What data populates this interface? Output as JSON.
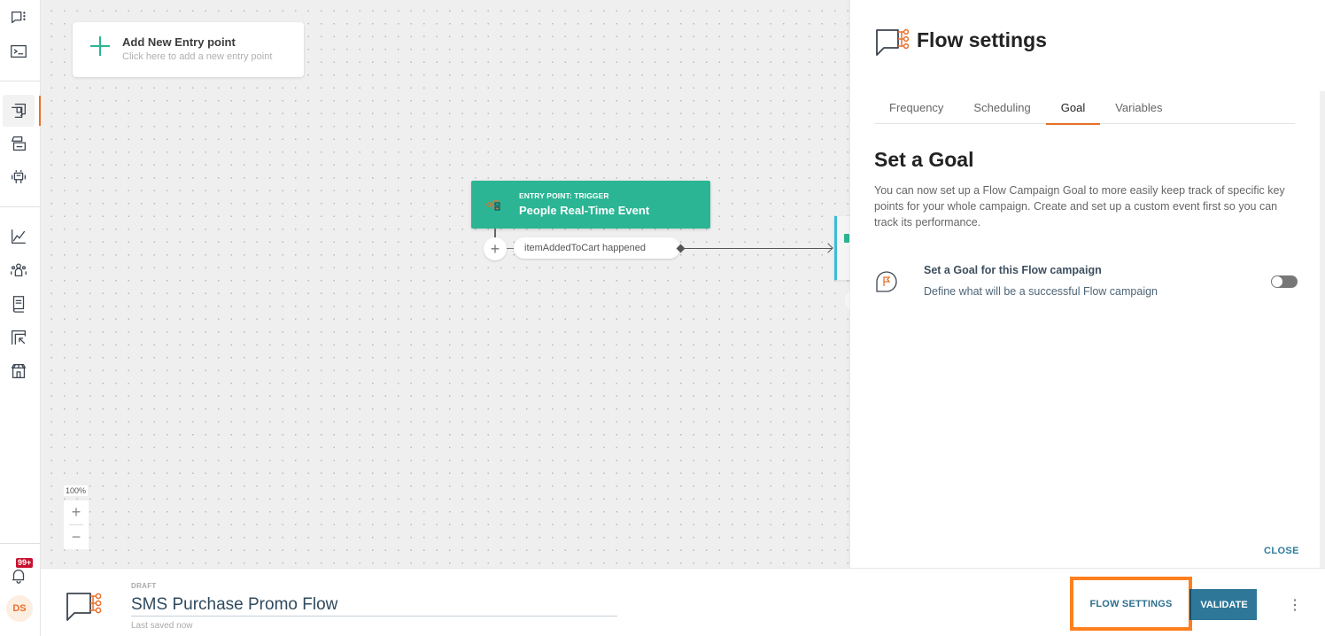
{
  "sidebar": {
    "items": [
      {
        "name": "conversations",
        "icon": "chat-dots-icon"
      },
      {
        "name": "terminal",
        "icon": "terminal-icon"
      },
      {
        "name": "flows",
        "icon": "flows-icon",
        "active": true
      },
      {
        "name": "templates",
        "icon": "template-icon"
      },
      {
        "name": "bots",
        "icon": "robot-icon"
      },
      {
        "name": "analytics",
        "icon": "chart-line-icon"
      },
      {
        "name": "people",
        "icon": "people-icon"
      },
      {
        "name": "library",
        "icon": "book-icon"
      },
      {
        "name": "integrations",
        "icon": "cursor-frame-icon"
      },
      {
        "name": "store",
        "icon": "store-icon"
      }
    ],
    "notifications_badge": "99+",
    "avatar_initials": "DS",
    "accent_color": "#e8702a"
  },
  "canvas": {
    "entry_card": {
      "title": "Add New Entry point",
      "subtitle": "Click here to add a new entry point"
    },
    "trigger_node": {
      "kicker": "ENTRY POINT: TRIGGER",
      "title": "People Real-Time Event",
      "color": "#2bb594"
    },
    "event_pill": "itemAddedToCart happened",
    "zoom_level": "100%",
    "zoom_in": "+",
    "zoom_out": "−"
  },
  "panel": {
    "title": "Flow settings",
    "tabs": [
      {
        "label": "Frequency"
      },
      {
        "label": "Scheduling"
      },
      {
        "label": "Goal",
        "active": true
      },
      {
        "label": "Variables"
      }
    ],
    "section_title": "Set a Goal",
    "section_description": "You can now set up a Flow Campaign Goal to more easily keep track of specific key points for your whole campaign. Create and set up a custom event first so you can track its performance.",
    "goal_option": {
      "title": "Set a Goal for this Flow campaign",
      "subtitle": "Define what will be a successful Flow campaign",
      "enabled": false
    },
    "close_label": "CLOSE"
  },
  "bottombar": {
    "status": "DRAFT",
    "flow_name": "SMS Purchase Promo Flow",
    "last_saved": "Last saved now",
    "flow_settings_label": "FLOW SETTINGS",
    "validate_label": "VALIDATE",
    "more_label": "⋮"
  }
}
